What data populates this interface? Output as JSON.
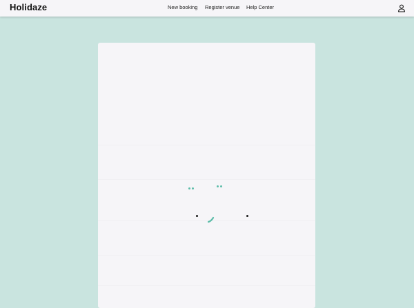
{
  "app": {
    "brand": "Holidaze"
  },
  "nav": {
    "links": [
      {
        "label": "New booking"
      },
      {
        "label": "Register venue"
      },
      {
        "label": "Help Center"
      }
    ]
  },
  "icons": {
    "user": "user-icon",
    "loading": "loading-spinner-icon"
  },
  "colors": {
    "page_background": "#c9e4df",
    "navbar_background": "#f6f5f8",
    "card_background": "#f6f5f8",
    "accent": "#5dbda9",
    "text": "#111111"
  }
}
